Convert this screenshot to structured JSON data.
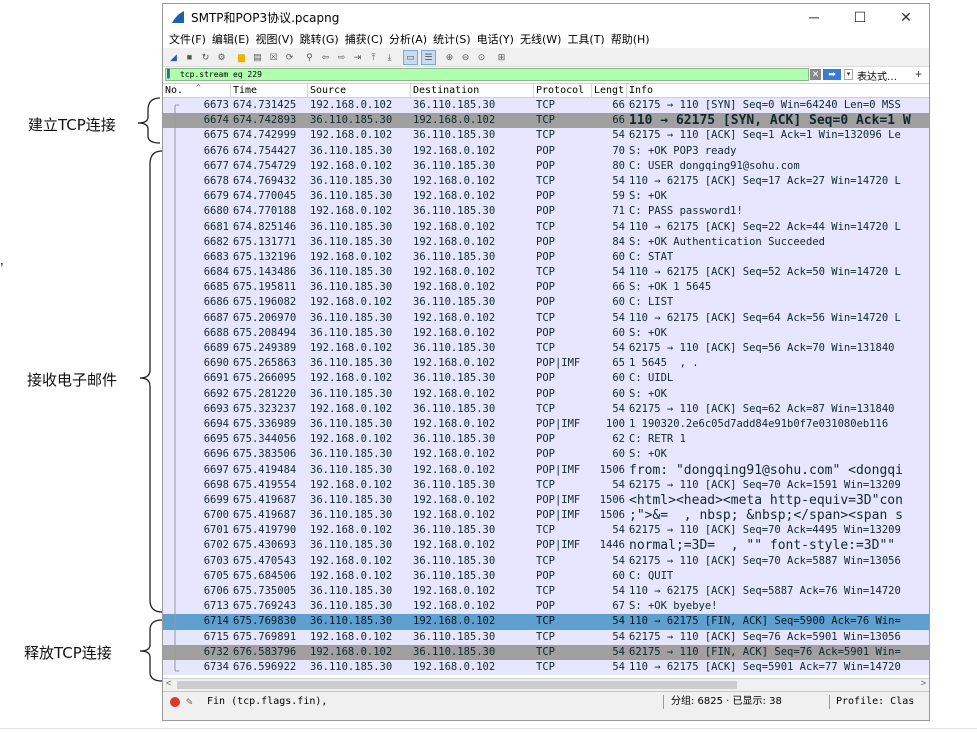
{
  "window": {
    "title": "SMTP和POP3协议.pcapng",
    "buttons": {
      "minimize": "─",
      "maximize": "☐",
      "close": "✕"
    }
  },
  "menu": [
    "文件(F)",
    "编辑(E)",
    "视图(V)",
    "跳转(G)",
    "捕获(C)",
    "分析(A)",
    "统计(S)",
    "电话(Y)",
    "无线(W)",
    "工具(T)",
    "帮助(H)"
  ],
  "toolbar_icons": [
    "shark-fin-icon",
    "stop-icon",
    "restart-icon",
    "options-icon",
    "open-icon",
    "save-icon",
    "close-file-icon",
    "reload-icon",
    "find-icon",
    "back-icon",
    "forward-icon",
    "goto-icon",
    "first-icon",
    "last-icon",
    "autoscroll-icon",
    "colorize-icon",
    "zoom-in-icon",
    "zoom-out-icon",
    "zoom-reset-icon",
    "resize-columns-icon"
  ],
  "filter": {
    "value": "tcp.stream eq 229",
    "expression_label": "表达式…",
    "plus": "+",
    "color": "#afffaf"
  },
  "columns": [
    "No.",
    "Time",
    "Source",
    "Destination",
    "Protocol",
    "Lengt",
    "Info"
  ],
  "colors": {
    "tcp_row": "#e7e6ff",
    "selected_dark": "#a0a0a0",
    "fin_row": "#a0a0a0",
    "fin_selected": "#5fa0d0"
  },
  "packets": [
    {
      "no": "6673",
      "time": "674.731425",
      "src": "192.168.0.102",
      "dst": "36.110.185.30",
      "proto": "TCP",
      "len": "66",
      "info": "62175 → 110 [SYN] Seq=0 Win=64240 Len=0 MSS",
      "style": "tcp"
    },
    {
      "no": "6674",
      "time": "674.742893",
      "src": "36.110.185.30",
      "dst": "192.168.0.102",
      "proto": "TCP",
      "len": "66",
      "info": "110 → 62175 [SYN, ACK] Seq=0 Ack=1 W",
      "style": "dark",
      "big": true
    },
    {
      "no": "6675",
      "time": "674.742999",
      "src": "192.168.0.102",
      "dst": "36.110.185.30",
      "proto": "TCP",
      "len": "54",
      "info": "62175 → 110 [ACK] Seq=1 Ack=1 Win=132096 Le",
      "style": "tcp"
    },
    {
      "no": "6676",
      "time": "674.754427",
      "src": "36.110.185.30",
      "dst": "192.168.0.102",
      "proto": "POP",
      "len": "70",
      "info": "S: +OK POP3 ready",
      "style": "tcp"
    },
    {
      "no": "6677",
      "time": "674.754729",
      "src": "192.168.0.102",
      "dst": "36.110.185.30",
      "proto": "POP",
      "len": "80",
      "info": "C: USER dongqing91@sohu.com",
      "style": "tcp"
    },
    {
      "no": "6678",
      "time": "674.769432",
      "src": "36.110.185.30",
      "dst": "192.168.0.102",
      "proto": "TCP",
      "len": "54",
      "info": "110 → 62175 [ACK] Seq=17 Ack=27 Win=14720 L",
      "style": "tcp"
    },
    {
      "no": "6679",
      "time": "674.770045",
      "src": "36.110.185.30",
      "dst": "192.168.0.102",
      "proto": "POP",
      "len": "59",
      "info": "S: +OK",
      "style": "tcp"
    },
    {
      "no": "6680",
      "time": "674.770188",
      "src": "192.168.0.102",
      "dst": "36.110.185.30",
      "proto": "POP",
      "len": "71",
      "info": "C: PASS password1!",
      "style": "tcp"
    },
    {
      "no": "6681",
      "time": "674.825146",
      "src": "36.110.185.30",
      "dst": "192.168.0.102",
      "proto": "TCP",
      "len": "54",
      "info": "110 → 62175 [ACK] Seq=22 Ack=44 Win=14720 L",
      "style": "tcp"
    },
    {
      "no": "6682",
      "time": "675.131771",
      "src": "36.110.185.30",
      "dst": "192.168.0.102",
      "proto": "POP",
      "len": "84",
      "info": "S: +OK Authentication Succeeded",
      "style": "tcp"
    },
    {
      "no": "6683",
      "time": "675.132196",
      "src": "192.168.0.102",
      "dst": "36.110.185.30",
      "proto": "POP",
      "len": "60",
      "info": "C: STAT",
      "style": "tcp"
    },
    {
      "no": "6684",
      "time": "675.143486",
      "src": "36.110.185.30",
      "dst": "192.168.0.102",
      "proto": "TCP",
      "len": "54",
      "info": "110 → 62175 [ACK] Seq=52 Ack=50 Win=14720 L",
      "style": "tcp"
    },
    {
      "no": "6685",
      "time": "675.195811",
      "src": "36.110.185.30",
      "dst": "192.168.0.102",
      "proto": "POP",
      "len": "66",
      "info": "S: +OK 1 5645",
      "style": "tcp"
    },
    {
      "no": "6686",
      "time": "675.196082",
      "src": "192.168.0.102",
      "dst": "36.110.185.30",
      "proto": "POP",
      "len": "60",
      "info": "C: LIST",
      "style": "tcp"
    },
    {
      "no": "6687",
      "time": "675.206970",
      "src": "36.110.185.30",
      "dst": "192.168.0.102",
      "proto": "TCP",
      "len": "54",
      "info": "110 → 62175 [ACK] Seq=64 Ack=56 Win=14720 L",
      "style": "tcp"
    },
    {
      "no": "6688",
      "time": "675.208494",
      "src": "36.110.185.30",
      "dst": "192.168.0.102",
      "proto": "POP",
      "len": "60",
      "info": "S: +OK",
      "style": "tcp"
    },
    {
      "no": "6689",
      "time": "675.249389",
      "src": "192.168.0.102",
      "dst": "36.110.185.30",
      "proto": "TCP",
      "len": "54",
      "info": "62175 → 110 [ACK] Seq=56 Ack=70 Win=131840",
      "style": "tcp"
    },
    {
      "no": "6690",
      "time": "675.265863",
      "src": "36.110.185.30",
      "dst": "192.168.0.102",
      "proto": "POP|IMF",
      "len": "65",
      "info": "1 5645  , .",
      "style": "tcp"
    },
    {
      "no": "6691",
      "time": "675.266095",
      "src": "192.168.0.102",
      "dst": "36.110.185.30",
      "proto": "POP",
      "len": "60",
      "info": "C: UIDL",
      "style": "tcp"
    },
    {
      "no": "6692",
      "time": "675.281220",
      "src": "36.110.185.30",
      "dst": "192.168.0.102",
      "proto": "POP",
      "len": "60",
      "info": "S: +OK",
      "style": "tcp"
    },
    {
      "no": "6693",
      "time": "675.323237",
      "src": "192.168.0.102",
      "dst": "36.110.185.30",
      "proto": "TCP",
      "len": "54",
      "info": "62175 → 110 [ACK] Seq=62 Ack=87 Win=131840",
      "style": "tcp"
    },
    {
      "no": "6694",
      "time": "675.336989",
      "src": "36.110.185.30",
      "dst": "192.168.0.102",
      "proto": "POP|IMF",
      "len": "100",
      "info": "1 190320.2e6c05d7add84e91b0f7e031080eb116",
      "style": "tcp"
    },
    {
      "no": "6695",
      "time": "675.344056",
      "src": "192.168.0.102",
      "dst": "36.110.185.30",
      "proto": "POP",
      "len": "62",
      "info": "C: RETR 1",
      "style": "tcp"
    },
    {
      "no": "6696",
      "time": "675.383506",
      "src": "36.110.185.30",
      "dst": "192.168.0.102",
      "proto": "POP",
      "len": "60",
      "info": "S: +OK",
      "style": "tcp"
    },
    {
      "no": "6697",
      "time": "675.419484",
      "src": "36.110.185.30",
      "dst": "192.168.0.102",
      "proto": "POP|IMF",
      "len": "1506",
      "info": "from: \"dongqing91@sohu.com\" <dongqi",
      "style": "tcp",
      "big": true
    },
    {
      "no": "6698",
      "time": "675.419554",
      "src": "192.168.0.102",
      "dst": "36.110.185.30",
      "proto": "TCP",
      "len": "54",
      "info": "62175 → 110 [ACK] Seq=70 Ack=1591 Win=13209",
      "style": "tcp"
    },
    {
      "no": "6699",
      "time": "675.419687",
      "src": "36.110.185.30",
      "dst": "192.168.0.102",
      "proto": "POP|IMF",
      "len": "1506",
      "info": "<html><head><meta http-equiv=3D\"con",
      "style": "tcp",
      "big": true
    },
    {
      "no": "6700",
      "time": "675.419687",
      "src": "36.110.185.30",
      "dst": "192.168.0.102",
      "proto": "POP|IMF",
      "len": "1506",
      "info": ";\">&=  , nbsp; &nbsp;</span><span s",
      "style": "tcp",
      "big": true
    },
    {
      "no": "6701",
      "time": "675.419790",
      "src": "192.168.0.102",
      "dst": "36.110.185.30",
      "proto": "TCP",
      "len": "54",
      "info": "62175 → 110 [ACK] Seq=70 Ack=4495 Win=13209",
      "style": "tcp"
    },
    {
      "no": "6702",
      "time": "675.430693",
      "src": "36.110.185.30",
      "dst": "192.168.0.102",
      "proto": "POP|IMF",
      "len": "1446",
      "info": "normal;=3D=  , \"\" font-style:=3D\"\"",
      "style": "tcp",
      "big": true
    },
    {
      "no": "6703",
      "time": "675.470543",
      "src": "192.168.0.102",
      "dst": "36.110.185.30",
      "proto": "TCP",
      "len": "54",
      "info": "62175 → 110 [ACK] Seq=70 Ack=5887 Win=13056",
      "style": "tcp"
    },
    {
      "no": "6705",
      "time": "675.684506",
      "src": "192.168.0.102",
      "dst": "36.110.185.30",
      "proto": "POP",
      "len": "60",
      "info": "C: QUIT",
      "style": "tcp"
    },
    {
      "no": "6706",
      "time": "675.735005",
      "src": "36.110.185.30",
      "dst": "192.168.0.102",
      "proto": "TCP",
      "len": "54",
      "info": "110 → 62175 [ACK] Seq=5887 Ack=76 Win=14720",
      "style": "tcp"
    },
    {
      "no": "6713",
      "time": "675.769243",
      "src": "36.110.185.30",
      "dst": "192.168.0.102",
      "proto": "POP",
      "len": "67",
      "info": "S: +OK byebye!",
      "style": "tcp"
    },
    {
      "no": "6714",
      "time": "675.769830",
      "src": "36.110.185.30",
      "dst": "192.168.0.102",
      "proto": "TCP",
      "len": "54",
      "info": "110 → 62175 [FIN, ACK] Seq=5900 Ack=76 Win=",
      "style": "fin_sel"
    },
    {
      "no": "6715",
      "time": "675.769891",
      "src": "192.168.0.102",
      "dst": "36.110.185.30",
      "proto": "TCP",
      "len": "54",
      "info": "62175 → 110 [ACK] Seq=76 Ack=5901 Win=13056",
      "style": "tcp"
    },
    {
      "no": "6732",
      "time": "676.583796",
      "src": "192.168.0.102",
      "dst": "36.110.185.30",
      "proto": "TCP",
      "len": "54",
      "info": "62175 → 110 [FIN, ACK] Seq=76 Ack=5901 Win=",
      "style": "fin"
    },
    {
      "no": "6734",
      "time": "676.596922",
      "src": "36.110.185.30",
      "dst": "192.168.0.102",
      "proto": "TCP",
      "len": "54",
      "info": "110 → 62175 [ACK] Seq=5901 Ack=77 Win=14720",
      "style": "tcp"
    }
  ],
  "status": {
    "filter_text": "Fin (tcp.flags.fin),",
    "counts": "分组: 6825 · 已显示: 38",
    "profile": "Profile: Clas"
  },
  "annotations": {
    "establish": "建立TCP连接",
    "receive": "接收电子邮件",
    "release": "释放TCP连接"
  },
  "left_mark": "’"
}
